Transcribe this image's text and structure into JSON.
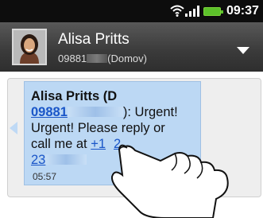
{
  "status_bar": {
    "time": "09:37",
    "icons": [
      "wifi-icon",
      "signal-icon",
      "battery-icon"
    ],
    "battery_color": "#5cc12a"
  },
  "header": {
    "contact_name": "Alisa Pritts",
    "contact_number_visible": "09881",
    "contact_label": "(Domov)",
    "avatar_icon": "contact-photo"
  },
  "message": {
    "sender": "Alisa Pritts (D",
    "number_link": "09881",
    "text_after_number": "): Urgent!",
    "body_line2": "Urgent! Please reply or",
    "body_line3_prefix": "call me at ",
    "phone_link_part1": "+1",
    "phone_link_part2": "2",
    "phone_link_part3": "23",
    "time": "05:57",
    "bubble_color": "#bcd8f4",
    "link_color": "#1a56c8"
  }
}
